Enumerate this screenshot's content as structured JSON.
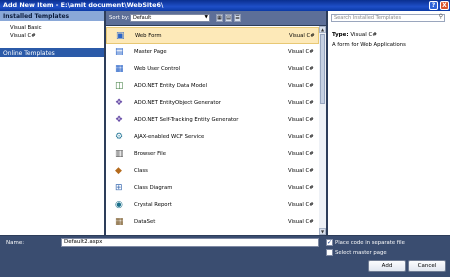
{
  "window": {
    "title": "Add New Item - E:\\amit document\\WebSite6\\",
    "help_label": "?",
    "close_label": "X"
  },
  "sidebar": {
    "header": "Installed Templates",
    "items": [
      {
        "label": "Visual Basic"
      },
      {
        "label": "Visual C#"
      }
    ],
    "online_label": "Online Templates"
  },
  "toolbar": {
    "sort_label": "Sort by:",
    "sort_value": "Default"
  },
  "templates": [
    {
      "name": "Web Form",
      "lang": "Visual C#",
      "icon": "web-form-icon",
      "selected": true
    },
    {
      "name": "Master Page",
      "lang": "Visual C#",
      "icon": "master-page-icon"
    },
    {
      "name": "Web User Control",
      "lang": "Visual C#",
      "icon": "user-control-icon"
    },
    {
      "name": "ADO.NET Entity Data Model",
      "lang": "Visual C#",
      "icon": "entity-model-icon"
    },
    {
      "name": "ADO.NET EntityObject Generator",
      "lang": "Visual C#",
      "icon": "generator-icon"
    },
    {
      "name": "ADO.NET Self-Tracking Entity Generator",
      "lang": "Visual C#",
      "icon": "generator-icon"
    },
    {
      "name": "AJAX-enabled WCF Service",
      "lang": "Visual C#",
      "icon": "wcf-service-icon"
    },
    {
      "name": "Browser File",
      "lang": "Visual C#",
      "icon": "browser-file-icon"
    },
    {
      "name": "Class",
      "lang": "Visual C#",
      "icon": "class-icon"
    },
    {
      "name": "Class Diagram",
      "lang": "Visual C#",
      "icon": "class-diagram-icon"
    },
    {
      "name": "Crystal Report",
      "lang": "Visual C#",
      "icon": "crystal-report-icon"
    },
    {
      "name": "DataSet",
      "lang": "Visual C#",
      "icon": "dataset-icon"
    }
  ],
  "search": {
    "placeholder": "Search Installed Templates"
  },
  "details": {
    "type_label": "Type:",
    "type_value": "Visual C#",
    "description": "A form for Web Applications"
  },
  "bottom": {
    "name_label": "Name:",
    "name_value": "Default2.aspx",
    "separate_code_label": "Place code in separate file",
    "separate_code_checked": true,
    "master_page_label": "Select master page",
    "master_page_checked": false,
    "add_label": "Add",
    "cancel_label": "Cancel"
  }
}
